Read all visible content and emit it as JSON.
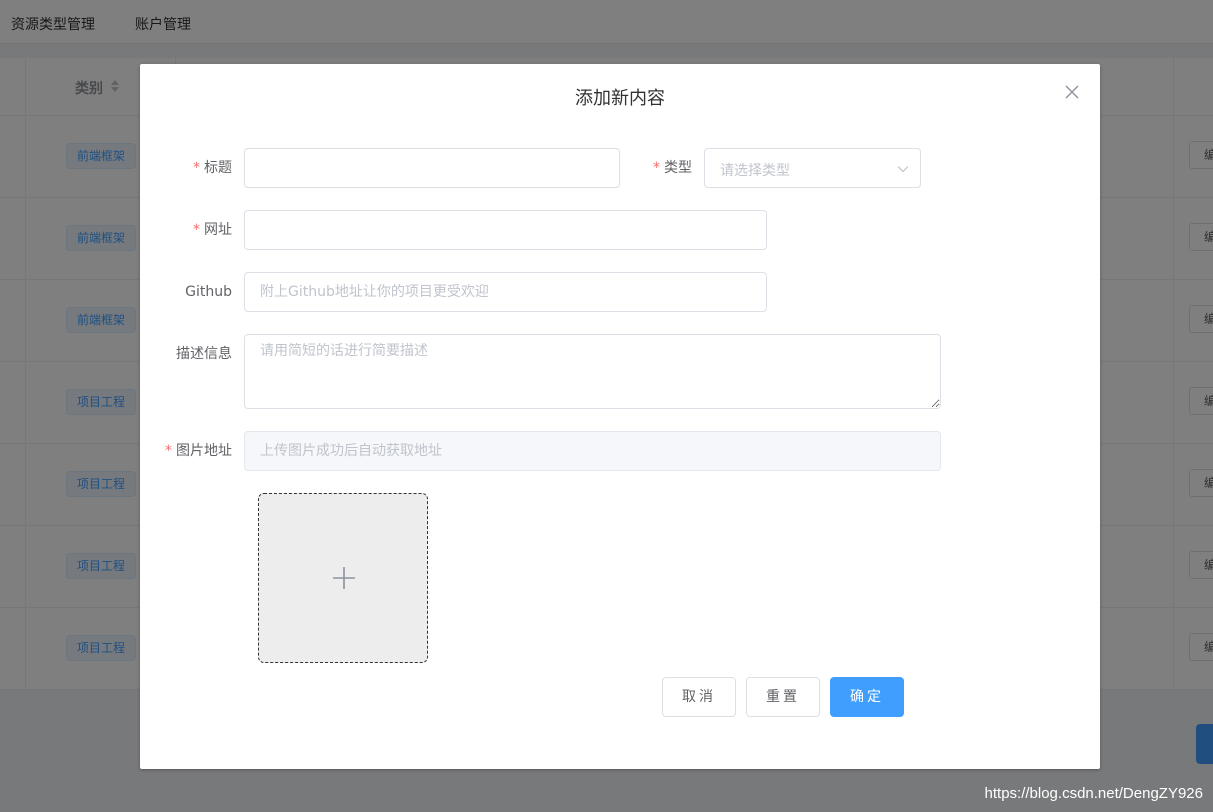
{
  "nav": {
    "items": [
      "资源类型管理",
      "账户管理"
    ]
  },
  "table": {
    "header": {
      "category_label": "类别"
    },
    "rows": [
      {
        "tag": "前端框架",
        "action": "编"
      },
      {
        "tag": "前端框架",
        "action": "编"
      },
      {
        "tag": "前端框架",
        "action": "编"
      },
      {
        "tag": "项目工程",
        "action": "编"
      },
      {
        "tag": "项目工程",
        "action": "编"
      },
      {
        "tag": "项目工程",
        "action": "编"
      },
      {
        "tag": "项目工程",
        "action": "编"
      }
    ]
  },
  "dialog": {
    "title": "添加新内容",
    "fields": {
      "title": {
        "label": "标题",
        "value": "",
        "placeholder": ""
      },
      "type": {
        "label": "类型",
        "placeholder": "请选择类型"
      },
      "url": {
        "label": "网址",
        "value": "",
        "placeholder": ""
      },
      "github": {
        "label": "Github",
        "placeholder": "附上Github地址让你的项目更受欢迎"
      },
      "description": {
        "label": "描述信息",
        "placeholder": "请用简短的话进行简要描述"
      },
      "image": {
        "label": "图片地址",
        "placeholder": "上传图片成功后自动获取地址"
      }
    },
    "required_mark": "*",
    "buttons": {
      "cancel": "取消",
      "reset": "重置",
      "confirm": "确定"
    }
  },
  "watermark": "https://blog.csdn.net/DengZY926",
  "colors": {
    "primary": "#409eff",
    "required": "#f56c6c",
    "tag_bg": "#ecf5ff"
  },
  "icons": {
    "close": "close-icon",
    "arrow": "chevron-down-icon",
    "plus": "plus-icon",
    "sort": "sort-icon"
  }
}
